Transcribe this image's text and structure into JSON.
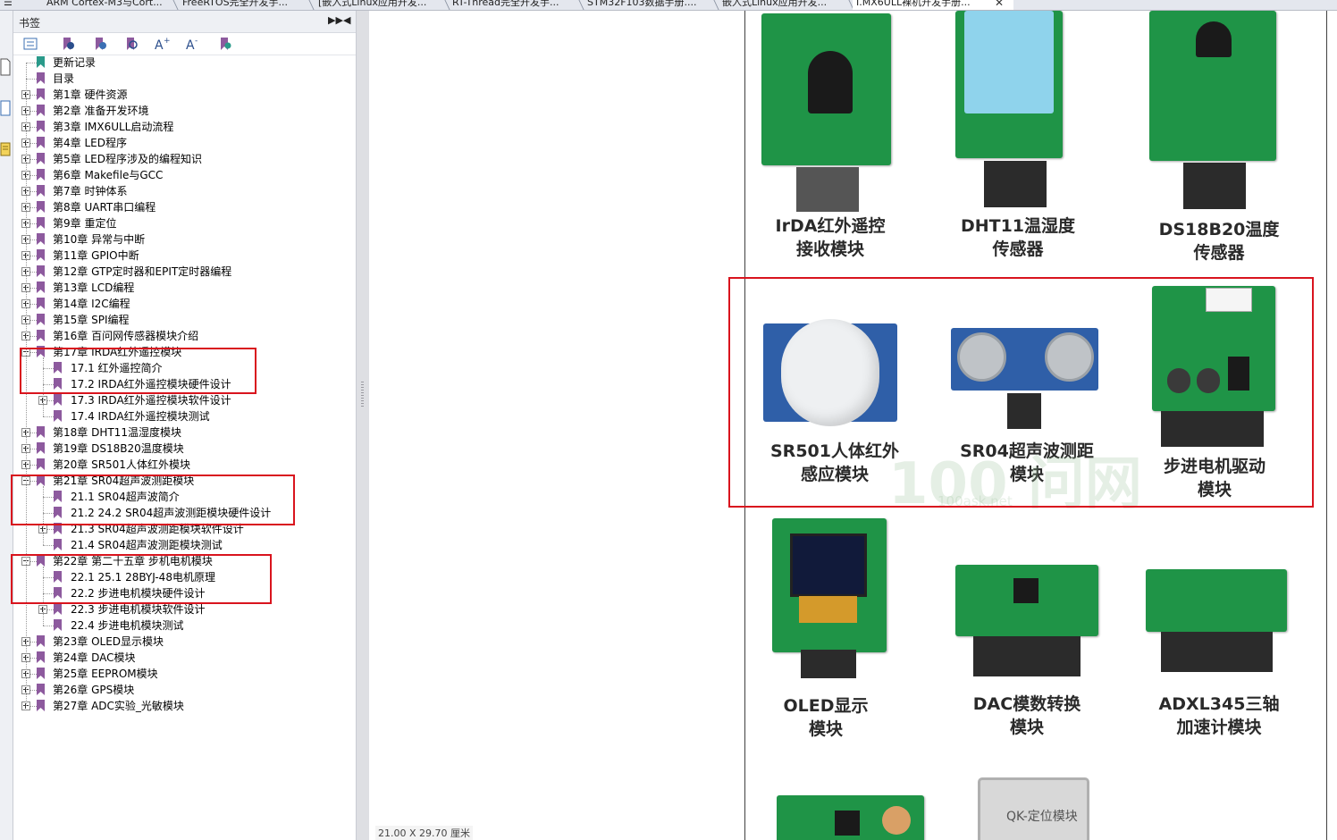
{
  "tabs": [
    {
      "label": "ARM Cortex-M3与Cort..."
    },
    {
      "label": "FreeRTOS完全开发手..."
    },
    {
      "label": "[嵌入式Linux应用开发..."
    },
    {
      "label": "RT-Thread完全开发手..."
    },
    {
      "label": "STM32F103数据手册...."
    },
    {
      "label": "嵌入式Linux应用开发..."
    },
    {
      "label": "I.MX6ULL裸机开发手册..."
    }
  ],
  "tab_close": "✕",
  "panel": {
    "title": "书签",
    "tools": [
      "expand-all-icon",
      "bookmark-add-icon",
      "bookmark-add-child-icon",
      "bookmark-search-icon",
      "font-increase-icon",
      "font-decrease-icon",
      "bookmark-goto-icon"
    ]
  },
  "bookmarks": [
    {
      "label": "更新记录",
      "level": 0,
      "expander": "none"
    },
    {
      "label": "目录",
      "level": 0,
      "expander": "none"
    },
    {
      "label": "第1章 硬件资源",
      "level": 0,
      "expander": "plus"
    },
    {
      "label": "第2章 准备开发环境",
      "level": 0,
      "expander": "plus"
    },
    {
      "label": "第3章 IMX6ULL启动流程",
      "level": 0,
      "expander": "plus"
    },
    {
      "label": "第4章 LED程序",
      "level": 0,
      "expander": "plus"
    },
    {
      "label": "第5章 LED程序涉及的编程知识",
      "level": 0,
      "expander": "plus"
    },
    {
      "label": "第6章 Makefile与GCC",
      "level": 0,
      "expander": "plus"
    },
    {
      "label": "第7章 时钟体系",
      "level": 0,
      "expander": "plus"
    },
    {
      "label": "第8章 UART串口编程",
      "level": 0,
      "expander": "plus"
    },
    {
      "label": "第9章 重定位",
      "level": 0,
      "expander": "plus"
    },
    {
      "label": "第10章 异常与中断",
      "level": 0,
      "expander": "plus"
    },
    {
      "label": "第11章 GPIO中断",
      "level": 0,
      "expander": "plus"
    },
    {
      "label": "第12章 GTP定时器和EPIT定时器编程",
      "level": 0,
      "expander": "plus"
    },
    {
      "label": "第13章 LCD编程",
      "level": 0,
      "expander": "plus"
    },
    {
      "label": "第14章 I2C编程",
      "level": 0,
      "expander": "plus"
    },
    {
      "label": "第15章 SPI编程",
      "level": 0,
      "expander": "plus"
    },
    {
      "label": "第16章 百问网传感器模块介绍",
      "level": 0,
      "expander": "plus"
    },
    {
      "label": "第17章 IRDA红外遥控模块",
      "level": 0,
      "expander": "minus"
    },
    {
      "label": "17.1 红外遥控简介",
      "level": 1,
      "expander": "none"
    },
    {
      "label": "17.2 IRDA红外遥控模块硬件设计",
      "level": 1,
      "expander": "none"
    },
    {
      "label": "17.3 IRDA红外遥控模块软件设计",
      "level": 1,
      "expander": "plus"
    },
    {
      "label": "17.4 IRDA红外遥控模块测试",
      "level": 1,
      "expander": "none"
    },
    {
      "label": "第18章 DHT11温湿度模块",
      "level": 0,
      "expander": "plus"
    },
    {
      "label": "第19章 DS18B20温度模块",
      "level": 0,
      "expander": "plus"
    },
    {
      "label": "第20章 SR501人体红外模块",
      "level": 0,
      "expander": "plus"
    },
    {
      "label": "第21章 SR04超声波测距模块",
      "level": 0,
      "expander": "minus"
    },
    {
      "label": "21.1 SR04超声波简介",
      "level": 1,
      "expander": "none"
    },
    {
      "label": "21.2 24.2 SR04超声波测距模块硬件设计",
      "level": 1,
      "expander": "none"
    },
    {
      "label": "21.3 SR04超声波测距模块软件设计",
      "level": 1,
      "expander": "plus"
    },
    {
      "label": "21.4 SR04超声波测距模块测试",
      "level": 1,
      "expander": "none"
    },
    {
      "label": "第22章 第二十五章 步机电机模块",
      "level": 0,
      "expander": "minus"
    },
    {
      "label": "22.1 25.1 28BYJ-48电机原理",
      "level": 1,
      "expander": "none"
    },
    {
      "label": "22.2 步进电机模块硬件设计",
      "level": 1,
      "expander": "none"
    },
    {
      "label": "22.3 步进电机模块软件设计",
      "level": 1,
      "expander": "plus"
    },
    {
      "label": "22.4 步进电机模块测试",
      "level": 1,
      "expander": "none"
    },
    {
      "label": "第23章 OLED显示模块",
      "level": 0,
      "expander": "plus"
    },
    {
      "label": "第24章 DAC模块",
      "level": 0,
      "expander": "plus"
    },
    {
      "label": "第25章 EEPROM模块",
      "level": 0,
      "expander": "plus"
    },
    {
      "label": "第26章 GPS模块",
      "level": 0,
      "expander": "plus"
    },
    {
      "label": "第27章 ADC实验_光敏模块",
      "level": 0,
      "expander": "plus"
    }
  ],
  "colors": {
    "highlight_box": "#d9141e",
    "bookmark_first": "#2a9a8a",
    "bookmark": "#8d5a9e",
    "pcb_green": "#1f9447"
  },
  "document": {
    "page_size": "21.00 X 29.70 厘米",
    "watermark": "100ask.net",
    "watermark_brand": "100 问网",
    "modules": [
      {
        "line1": "IrDA红外遥控",
        "line2": "接收模块"
      },
      {
        "line1": "DHT11温湿度",
        "line2": "传感器"
      },
      {
        "line1": "DS18B20温度",
        "line2": "传感器"
      },
      {
        "line1": "SR501人体红外",
        "line2": "感应模块"
      },
      {
        "line1": "SR04超声波测距",
        "line2": "模块"
      },
      {
        "line1": "步进电机驱动",
        "line2": "模块"
      },
      {
        "line1": "OLED显示",
        "line2": "模块"
      },
      {
        "line1": "DAC模数转换",
        "line2": "模块"
      },
      {
        "line1": "ADXL345三轴",
        "line2": "加速计模块"
      }
    ],
    "gps_label": "QK-定位模块"
  }
}
